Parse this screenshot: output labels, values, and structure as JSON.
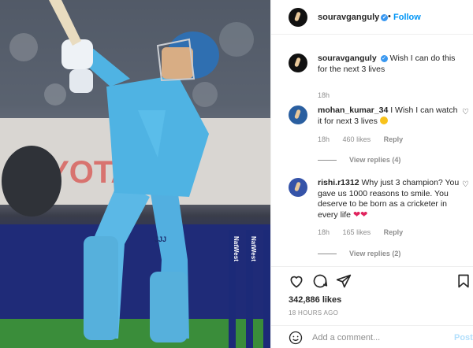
{
  "post": {
    "author": "souravganguly",
    "follow_label": "Follow",
    "separator": "•",
    "verified_mark": "✓",
    "caption": "Wish I can do this for the next 3 lives",
    "caption_age": "18h",
    "likes": "342,886 likes",
    "posted_ago": "18 HOURS AGO"
  },
  "photo": {
    "banner_text": "OYOTA A",
    "shirt_text": "JJJ",
    "stump_text": "NatWest"
  },
  "comments": [
    {
      "username": "mohan_kumar_34",
      "text": "I Wish I can watch it for next 3 lives",
      "emoji": "face-with-heart-eyes",
      "age": "18h",
      "likes": "460 likes",
      "reply_label": "Reply",
      "view_replies": "View replies (4)"
    },
    {
      "username": "rishi.r1312",
      "text": "Why just 3 champion? You gave us 1000 reasons to smile. You deserve to be born as a cricketer in every life",
      "hearts": "❤❤",
      "age": "18h",
      "likes": "165 likes",
      "reply_label": "Reply",
      "view_replies": "View replies (2)"
    }
  ],
  "composer": {
    "placeholder": "Add a comment...",
    "post_label": "Post"
  },
  "icons": {
    "like": "heart-outline-icon",
    "comment": "comment-bubble-icon",
    "share": "paper-plane-icon",
    "save": "bookmark-icon",
    "emoji": "smiley-icon"
  },
  "colors": {
    "link_blue": "#0095f6",
    "post_disabled": "#b2dffc",
    "muted": "#8e8e8e",
    "jersey": "#4fb3e3"
  }
}
